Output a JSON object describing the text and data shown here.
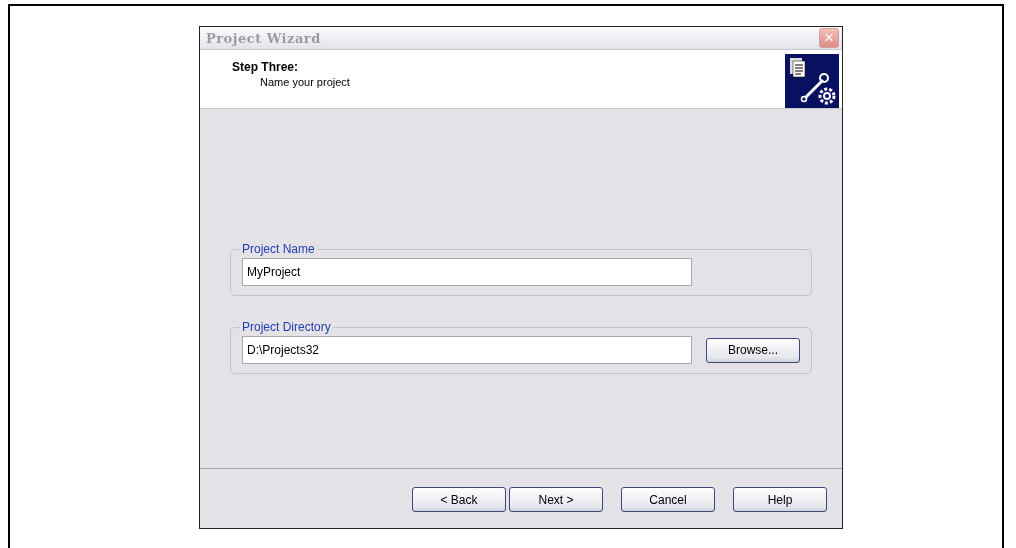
{
  "window": {
    "title": "Project Wizard",
    "close": "×"
  },
  "header": {
    "step": "Step Three:",
    "subtitle": "Name your project"
  },
  "groups": [
    {
      "label": "Project Name",
      "value": "MyProject"
    },
    {
      "label": "Project Directory",
      "value": "D:\\Projects32",
      "button": "Browse..."
    }
  ],
  "buttons": [
    {
      "label": "< Back"
    },
    {
      "label": "Next >"
    },
    {
      "label": "Cancel"
    },
    {
      "label": "Help"
    }
  ]
}
